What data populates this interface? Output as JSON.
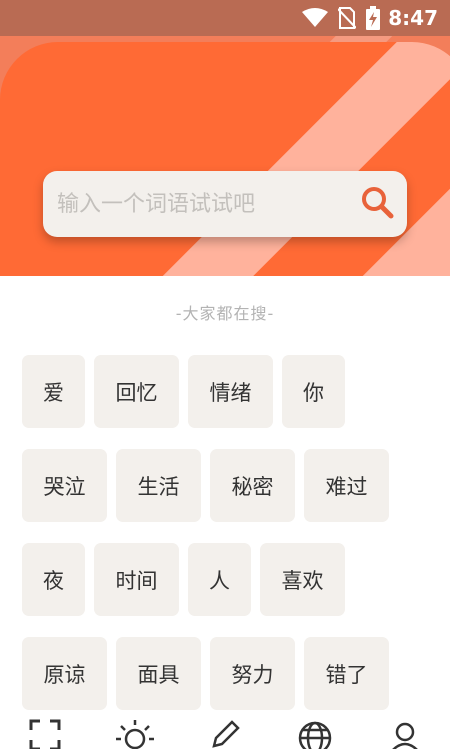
{
  "status_bar": {
    "time": "8:47",
    "icons": [
      "wifi-icon",
      "no-sim-icon",
      "battery-charging-icon"
    ]
  },
  "colors": {
    "accent": "#ff6a35",
    "hero_background": "#f37e5a",
    "stripe": "#ffb29c",
    "tag_background": "#f3f0ec",
    "search_icon": "#e8623a"
  },
  "search": {
    "placeholder": "输入一个词语试试吧",
    "icon": "search-icon"
  },
  "hot_searches": {
    "title": "-大家都在搜-",
    "rows": [
      [
        "爱",
        "回忆",
        "情绪",
        "你"
      ],
      [
        "哭泣",
        "生活",
        "秘密",
        "难过"
      ],
      [
        "夜",
        "时间",
        "人",
        "喜欢"
      ],
      [
        "原谅",
        "面具",
        "努力",
        "错了"
      ]
    ]
  },
  "bottom_nav": {
    "items": [
      "scan-icon",
      "sun-icon",
      "pen-icon",
      "globe-icon",
      "user-icon"
    ]
  }
}
